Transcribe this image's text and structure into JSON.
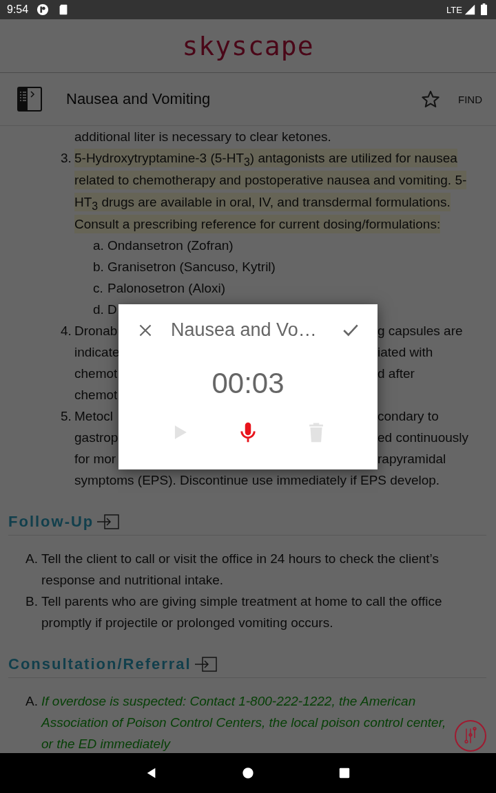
{
  "status_bar": {
    "time": "9:54",
    "network": "LTE"
  },
  "app_header": {
    "logo": "skyscape"
  },
  "toolbar": {
    "title": "Nausea and Vomiting",
    "find_label": "FIND"
  },
  "body": [
    {
      "kind": "continuation",
      "text": "additional liter is necessary to clear ketones."
    },
    {
      "kind": "item",
      "marker": "3.",
      "text": "5-Hydroxytryptamine-3 (5-HT$_{3}$) antagonists are utilized for nausea related to chemotherapy and postoperative nausea and vomiting. 5-HT$_{3}$ drugs are available in oral, IV, and transdermal formulations.",
      "highlighted": true
    },
    {
      "kind": "continuation",
      "text": "Consult a prescribing reference for current dosing/formulations:",
      "highlighted": true
    },
    {
      "kind": "subitem",
      "marker": "a.",
      "text": "Ondansetron (Zofran)"
    },
    {
      "kind": "subitem",
      "marker": "b.",
      "text": "Granisetron (Sancuso, Kytril)"
    },
    {
      "kind": "subitem",
      "marker": "c.",
      "text": "Palonosetron (Aloxi)"
    },
    {
      "kind": "covered_subitem",
      "marker": "d.",
      "left": "D"
    },
    {
      "kind": "covered_item",
      "marker": "4.",
      "left": "Dronab",
      "right": "g capsules are"
    },
    {
      "kind": "covered_item",
      "left": "indicate",
      "right": "iated with"
    },
    {
      "kind": "covered_item",
      "left": "chemot",
      "right": "d after"
    },
    {
      "kind": "covered_item",
      "left": "chemot"
    },
    {
      "kind": "covered_item",
      "marker": "5.",
      "left": "Metocl",
      "right": "condary to"
    },
    {
      "kind": "covered_item",
      "left": "gastrop",
      "right": "ed continuously"
    },
    {
      "kind": "covered_item",
      "left": "for mor",
      "right": "rapyramidal"
    },
    {
      "kind": "continuation",
      "text": "symptoms (EPS). Discontinue use immediately if EPS develop."
    }
  ],
  "sections": [
    {
      "title": "Follow-Up",
      "items": [
        {
          "kind": "plain",
          "marker": "A.",
          "text": "Tell the client to call or visit the office in 24 hours to check the client’s response and nutritional intake."
        },
        {
          "kind": "plain",
          "marker": "B.",
          "text": "Tell parents who are giving simple treatment at home to call the office promptly if projectile or prolonged vomiting occurs."
        }
      ]
    },
    {
      "title": "Consultation/Referral",
      "items": [
        {
          "kind": "alert",
          "marker": "A.",
          "text": "If overdose is suspected: Contact 1-800-222-1222, the American Association of Poison Control Centers, the local poison control center, or the ED immediately"
        }
      ]
    }
  ],
  "dialog": {
    "title": "Nausea and Vo…",
    "timer": "00:03",
    "controls": [
      {
        "kind": "play",
        "disabled": true
      },
      {
        "kind": "mic",
        "active": true
      },
      {
        "kind": "delete",
        "disabled": true
      }
    ]
  }
}
